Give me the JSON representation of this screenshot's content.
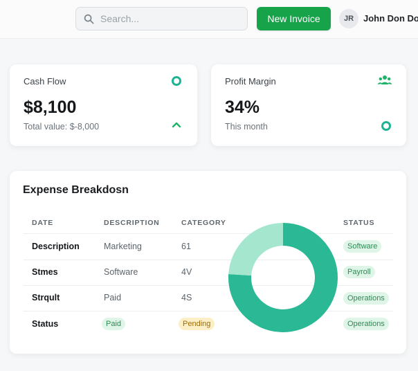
{
  "topbar": {
    "search_placeholder": "Search...",
    "new_invoice_label": "New Invoice",
    "avatar_initials": "JR",
    "user_name": "John Don Doo"
  },
  "kpis": [
    {
      "label": "Cash Flow",
      "value": "$8,100",
      "sub": "Total value: $-8,000",
      "trend": "up"
    },
    {
      "label": "Profit Margin",
      "value": "34%",
      "sub": "This month"
    }
  ],
  "expense": {
    "title": "Expense Breakdosn",
    "columns": [
      "DATE",
      "DESCRIPTION",
      "CATEGORY",
      "STATUS"
    ],
    "rows": [
      {
        "date": "Description",
        "description": "Marketing",
        "category": "61",
        "status": "Software"
      },
      {
        "date": "Stmes",
        "description": "Software",
        "category": "4V",
        "status": "Payroll"
      },
      {
        "date": "Strqult",
        "description": "Paid",
        "category": "4S",
        "status": "Operations"
      },
      {
        "date": "Status",
        "description": "Paid",
        "category": "Pending",
        "status": "Operations"
      }
    ],
    "donut": {
      "segments": [
        {
          "share": 0.76,
          "color": "#2bb894"
        },
        {
          "share": 0.24,
          "color": "#a5e6cf"
        }
      ]
    }
  },
  "colors": {
    "accent_green": "#17a34a",
    "teal": "#1fb394",
    "pill_green_bg": "#dff5e7",
    "pill_amber_bg": "#fcefc6"
  }
}
